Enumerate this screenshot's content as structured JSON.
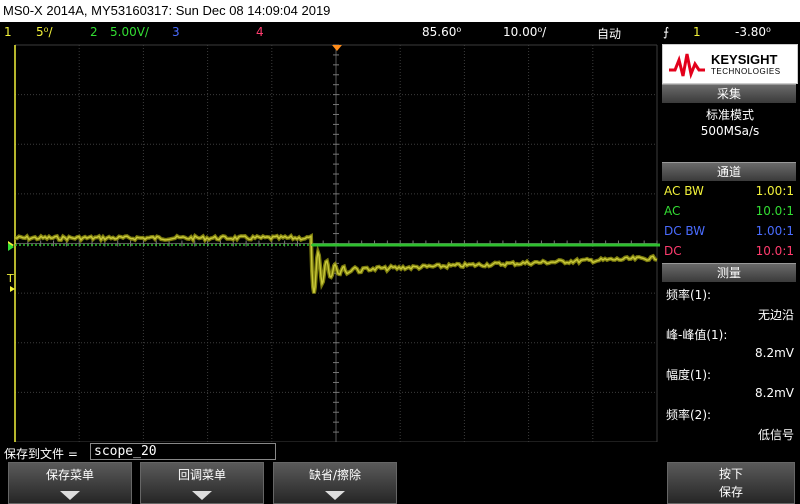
{
  "title": "MS0-X 2014A, MY53160317: Sun Dec 08 14:09:04 2019",
  "status": {
    "ch1_num": "1",
    "ch1_scale": "5⁰/",
    "ch2_num": "2",
    "ch2_scale": "5.00V/",
    "ch3_num": "3",
    "ch4_num": "4",
    "timebase_pos": "85.60⁰",
    "timebase_scale": "10.00⁰/",
    "trigger_mode": "自动",
    "trigger_ch": "1",
    "trigger_level": "-3.80⁰",
    "colors": {
      "ch1": "#f2f23a",
      "ch2": "#33dd33",
      "ch3": "#4a6cff",
      "ch4": "#ff3c6e"
    }
  },
  "brand": {
    "name": "KEYSIGHT",
    "sub": "TECHNOLOGIES",
    "logo_icon": "keysight-wave-logo"
  },
  "acquisition": {
    "header": "采集",
    "mode": "标准模式",
    "rate": "500MSa/s"
  },
  "channels": {
    "header": "通道",
    "rows": [
      {
        "coupling": "AC BW",
        "probe": "1.00:1"
      },
      {
        "coupling": "AC",
        "probe": "10.0:1"
      },
      {
        "coupling": "DC BW",
        "probe": "1.00:1"
      },
      {
        "coupling": "DC",
        "probe": "10.0:1"
      }
    ]
  },
  "measure": {
    "header": "测量",
    "items": [
      {
        "label": "频率(1):",
        "value": "无边沿"
      },
      {
        "label": "峰-峰值(1):",
        "value": "8.2mV"
      },
      {
        "label": "幅度(1):",
        "value": "8.2mV"
      },
      {
        "label": "频率(2):",
        "value": "低信号"
      }
    ]
  },
  "save": {
    "label": "保存到文件 =",
    "filename": "scope_20"
  },
  "softkeys": {
    "save_menu": "保存菜单",
    "recall_menu": "回调菜单",
    "default_erase": "缺省/擦除",
    "press_label": "按下",
    "press_action": "保存"
  }
}
